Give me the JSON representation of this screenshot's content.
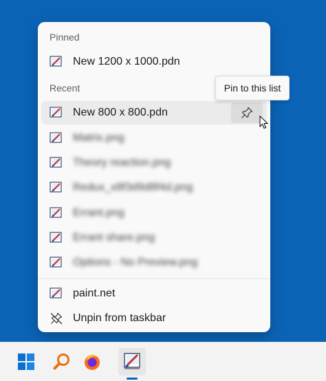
{
  "jumplist": {
    "pinned_label": "Pinned",
    "pinned_items": [
      {
        "label": "New 1200 x 1000.pdn",
        "icon": "paintnet-document-icon"
      }
    ],
    "recent_label": "Recent",
    "recent_items": [
      {
        "label": "New 800 x 800.pdn",
        "icon": "paintnet-document-icon",
        "hovered": true
      },
      {
        "label": "Matrix.png",
        "icon": "paintnet-document-icon",
        "blurred": true
      },
      {
        "label": "Theory reaction.png",
        "icon": "paintnet-document-icon",
        "blurred": true
      },
      {
        "label": "Redux_x8f3d9d8f4d.png",
        "icon": "paintnet-document-icon",
        "blurred": true
      },
      {
        "label": "Errant.png",
        "icon": "paintnet-document-icon",
        "blurred": true
      },
      {
        "label": "Errant share.png",
        "icon": "paintnet-document-icon",
        "blurred": true
      },
      {
        "label": "Options - No Preview.png",
        "icon": "paintnet-document-icon",
        "blurred": true
      }
    ],
    "tasks": [
      {
        "label": "paint.net",
        "icon": "paintnet-app-icon"
      },
      {
        "label": "Unpin from taskbar",
        "icon": "unpin-icon"
      }
    ],
    "pin_button_icon": "pin-icon",
    "tooltip": "Pin to this list"
  },
  "taskbar": {
    "buttons": [
      {
        "icon": "windows-start-icon"
      },
      {
        "icon": "search-icon"
      },
      {
        "icon": "firefox-icon"
      },
      {
        "icon": "paintnet-app-icon",
        "active": true
      }
    ]
  },
  "colors": {
    "desktop": "#0b63b6",
    "menu_bg": "#f9f9f9",
    "hover_bg": "#ebebeb",
    "taskbar_bg": "#f3f3f3",
    "accent": "#0067c0"
  }
}
